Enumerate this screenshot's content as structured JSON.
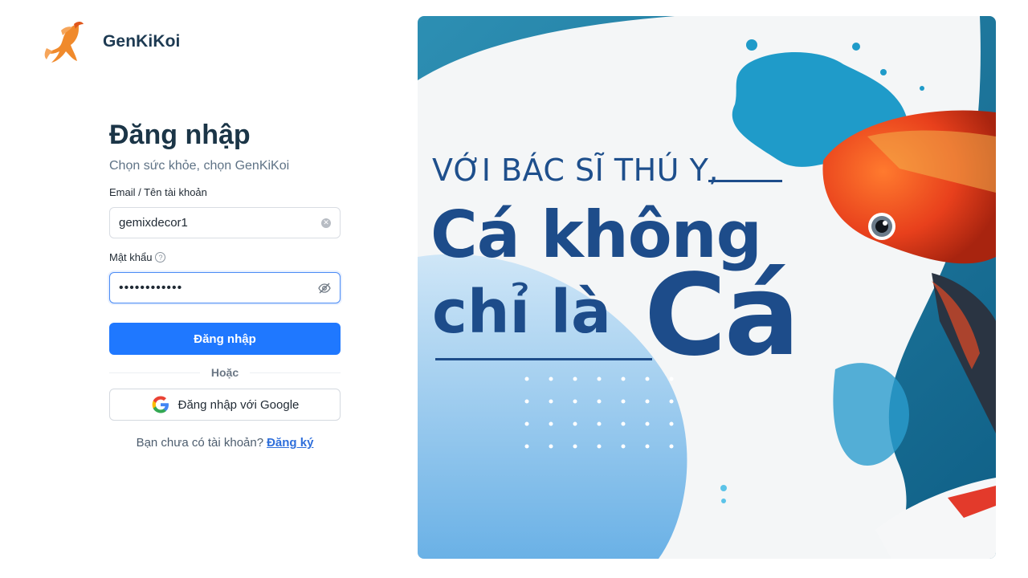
{
  "brand": {
    "name": "GenKiKoi",
    "logo_icon": "koi-logo-icon"
  },
  "login": {
    "title": "Đăng nhập",
    "subtitle": "Chọn sức khỏe, chọn GenKiKoi",
    "email_label": "Email / Tên tài khoản",
    "email_value": "gemixdecor1",
    "password_label": "Mật khẩu",
    "password_value": "••••••••••••",
    "submit_label": "Đăng nhập",
    "divider_label": "Hoặc",
    "google_label": "Đăng nhập với Google",
    "signup_prompt": "Bạn chưa có tài khoản?",
    "signup_link": "Đăng ký"
  },
  "banner": {
    "line1": "VỚI BÁC SĨ THÚ Y,",
    "line2": "Cá không",
    "line3": "chỉ là",
    "line4": "Cá"
  },
  "colors": {
    "primary": "#1f78ff",
    "brand_orange": "#f08a2c",
    "heading": "#1b3547",
    "banner_text": "#1d4c8a"
  }
}
